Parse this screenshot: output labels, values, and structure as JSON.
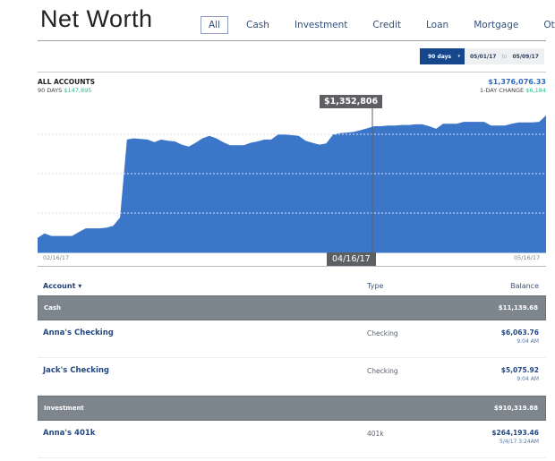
{
  "header": {
    "title": "Net Worth",
    "tabs": [
      {
        "label": "All",
        "active": true
      },
      {
        "label": "Cash",
        "active": false
      },
      {
        "label": "Investment",
        "active": false
      },
      {
        "label": "Credit",
        "active": false
      },
      {
        "label": "Loan",
        "active": false
      },
      {
        "label": "Mortgage",
        "active": false
      },
      {
        "label": "Other",
        "active": false
      }
    ]
  },
  "date_range": {
    "selected": "90 days",
    "caret": "▾",
    "start": "05/01/17",
    "to_label": "to",
    "end": "05/09/17"
  },
  "summary": {
    "label": "ALL ACCOUNTS",
    "period_label": "90 DAYS",
    "period_change": "$147,895",
    "total": "$1,376,076.33",
    "day_change_label": "1-DAY CHANGE",
    "day_change": "$6,184"
  },
  "tooltip": {
    "value": "$1,352,806",
    "date": "04/16/17"
  },
  "chart_data": {
    "type": "area",
    "title": "Net Worth",
    "x_start_label": "02/16/17",
    "x_end_label": "05/16/17",
    "hover_index": 44,
    "color": "#3b76c9",
    "grid": true,
    "gridlines": 3,
    "ylim": [
      1160000,
      1400000
    ],
    "values": [
      1183000,
      1190000,
      1186000,
      1186000,
      1186000,
      1186000,
      1192000,
      1198000,
      1198000,
      1198000,
      1199000,
      1202000,
      1215000,
      1338000,
      1340000,
      1339000,
      1338000,
      1334000,
      1338000,
      1336000,
      1335000,
      1330000,
      1327000,
      1333000,
      1340000,
      1344000,
      1340000,
      1334000,
      1329000,
      1329000,
      1329000,
      1333000,
      1335000,
      1338000,
      1338000,
      1346000,
      1346000,
      1345000,
      1344000,
      1336000,
      1333000,
      1330000,
      1332000,
      1346000,
      1348000,
      1349000,
      1350000,
      1352806,
      1356000,
      1359000,
      1359000,
      1360000,
      1360000,
      1361000,
      1361000,
      1362000,
      1362000,
      1359000,
      1355000,
      1363000,
      1363000,
      1363000,
      1366000,
      1366000,
      1366000,
      1366000,
      1360000,
      1360000,
      1360000,
      1363000,
      1365000,
      1365000,
      1365000,
      1366000,
      1376076
    ]
  },
  "table": {
    "columns": {
      "account": "Account",
      "account_sort": "▾",
      "type": "Type",
      "balance": "Balance"
    },
    "groups": [
      {
        "name": "Cash",
        "total": "$11,139.68",
        "rows": [
          {
            "name": "Anna's Checking",
            "type": "Checking",
            "balance": "$6,063.76",
            "updated": "9:04 AM"
          },
          {
            "name": "Jack's Checking",
            "type": "Checking",
            "balance": "$5,075.92",
            "updated": "9:04 AM"
          }
        ]
      },
      {
        "name": "Investment",
        "total": "$910,319.88",
        "rows": [
          {
            "name": "Anna's 401k",
            "type": "401k",
            "balance": "$264,193.46",
            "updated": "5/4/17 3:24AM"
          }
        ]
      }
    ]
  }
}
